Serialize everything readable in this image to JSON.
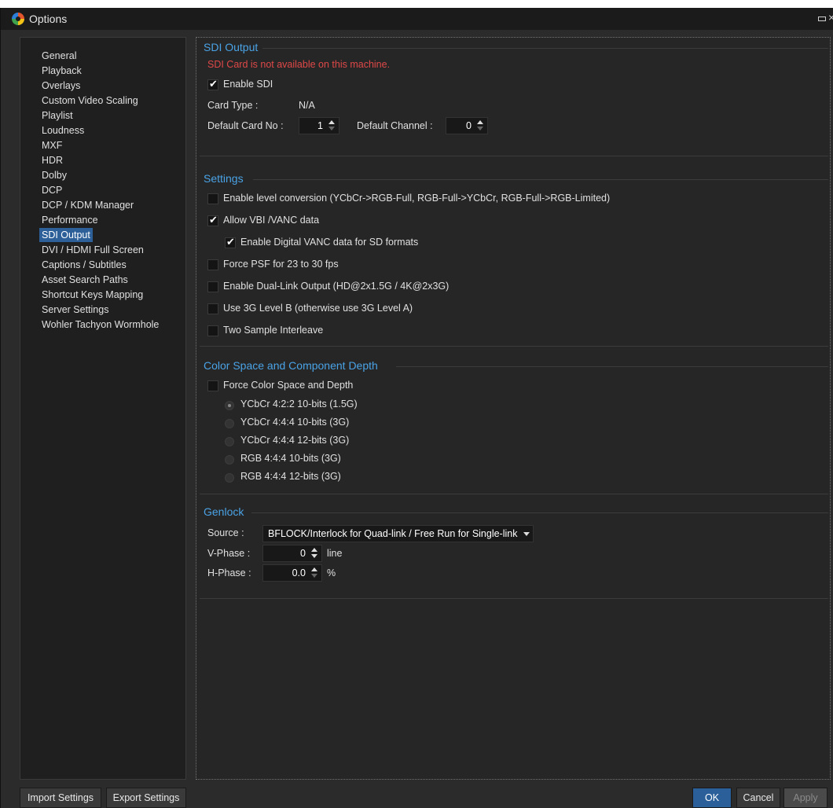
{
  "window": {
    "title": "Options"
  },
  "sidebar": {
    "selected_index": 12,
    "items": [
      {
        "label": "General"
      },
      {
        "label": "Playback"
      },
      {
        "label": "Overlays"
      },
      {
        "label": "Custom Video Scaling"
      },
      {
        "label": "Playlist"
      },
      {
        "label": "Loudness"
      },
      {
        "label": "MXF"
      },
      {
        "label": "HDR"
      },
      {
        "label": "Dolby"
      },
      {
        "label": "DCP"
      },
      {
        "label": "DCP / KDM Manager"
      },
      {
        "label": "Performance"
      },
      {
        "label": "SDI Output"
      },
      {
        "label": "DVI / HDMI Full Screen"
      },
      {
        "label": "Captions / Subtitles"
      },
      {
        "label": "Asset Search Paths"
      },
      {
        "label": "Shortcut Keys Mapping"
      },
      {
        "label": "Server Settings"
      },
      {
        "label": "Wohler Tachyon Wormhole"
      }
    ]
  },
  "sdi_output": {
    "title": "SDI Output",
    "warning": "SDI Card is not available on this machine.",
    "enable_sdi": {
      "label": "Enable SDI",
      "checked": true
    },
    "card_type_label": "Card Type :",
    "card_type_value": "N/A",
    "default_card_label": "Default Card No :",
    "default_card_value": "1",
    "default_channel_label": "Default Channel :",
    "default_channel_value": "0"
  },
  "settings": {
    "title": "Settings",
    "options": [
      {
        "label": "Enable level conversion (YCbCr->RGB-Full, RGB-Full->YCbCr, RGB-Full->RGB-Limited)",
        "checked": false
      },
      {
        "label": "Allow VBI /VANC data",
        "checked": true
      },
      {
        "label": "Enable Digital VANC data for SD formats",
        "checked": true
      },
      {
        "label": "Force PSF for 23 to 30 fps",
        "checked": false
      },
      {
        "label": "Enable Dual-Link Output (HD@2x1.5G / 4K@2x3G)",
        "checked": false
      },
      {
        "label": "Use 3G Level B (otherwise use 3G Level A)",
        "checked": false
      },
      {
        "label": "Two Sample Interleave",
        "checked": false
      }
    ]
  },
  "color_space": {
    "title": "Color Space and Component Depth",
    "force": {
      "label": "Force Color Space and Depth",
      "checked": false
    },
    "radios": [
      {
        "label": "YCbCr 4:2:2 10-bits (1.5G)",
        "selected": true
      },
      {
        "label": "YCbCr 4:4:4 10-bits (3G)",
        "selected": false
      },
      {
        "label": "YCbCr 4:4:4 12-bits (3G)",
        "selected": false
      },
      {
        "label": "RGB 4:4:4 10-bits (3G)",
        "selected": false
      },
      {
        "label": "RGB 4:4:4 12-bits (3G)",
        "selected": false
      }
    ]
  },
  "genlock": {
    "title": "Genlock",
    "source_label": "Source :",
    "source_value": "BFLOCK/Interlock for Quad-link / Free Run for Single-link",
    "vphase_label": "V-Phase :",
    "vphase_value": "0",
    "vphase_unit": "line",
    "hphase_label": "H-Phase :",
    "hphase_value": "0.0",
    "hphase_unit": "%"
  },
  "footer": {
    "import_label": "Import Settings",
    "export_label": "Export Settings",
    "ok_label": "OK",
    "cancel_label": "Cancel",
    "apply_label": "Apply"
  }
}
